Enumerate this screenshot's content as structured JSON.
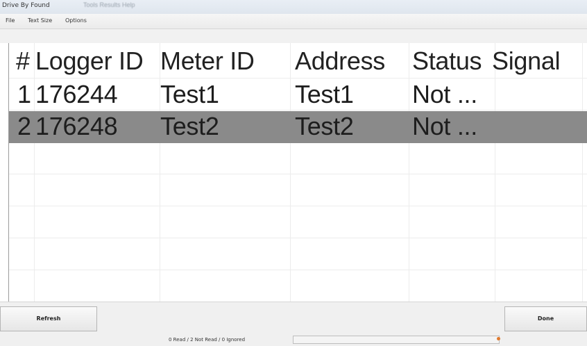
{
  "window": {
    "title": "Drive By Found",
    "ghost_title": "Tools   Results   Help"
  },
  "menu": {
    "items": [
      "File",
      "Text Size",
      "Options"
    ]
  },
  "grid": {
    "columns": [
      "#",
      "Logger ID",
      "Meter ID",
      "Address",
      "Status",
      "Signal"
    ],
    "rows": [
      {
        "num": "1",
        "logger_id": "176244",
        "meter_id": "Test1",
        "address": "Test1",
        "status": "Not ...",
        "signal": "",
        "selected": false
      },
      {
        "num": "2",
        "logger_id": "176248",
        "meter_id": "Test2",
        "address": "Test2",
        "status": "Not ...",
        "signal": "",
        "selected": true
      }
    ]
  },
  "footer": {
    "refresh_label": "Refresh",
    "done_label": "Done",
    "status_text": "0 Read / 2 Not Read / 0 Ignored",
    "progress_fraction": 0
  },
  "colors": {
    "selected_row": "#8a8a8a",
    "status_dot": "#e07a2e"
  }
}
